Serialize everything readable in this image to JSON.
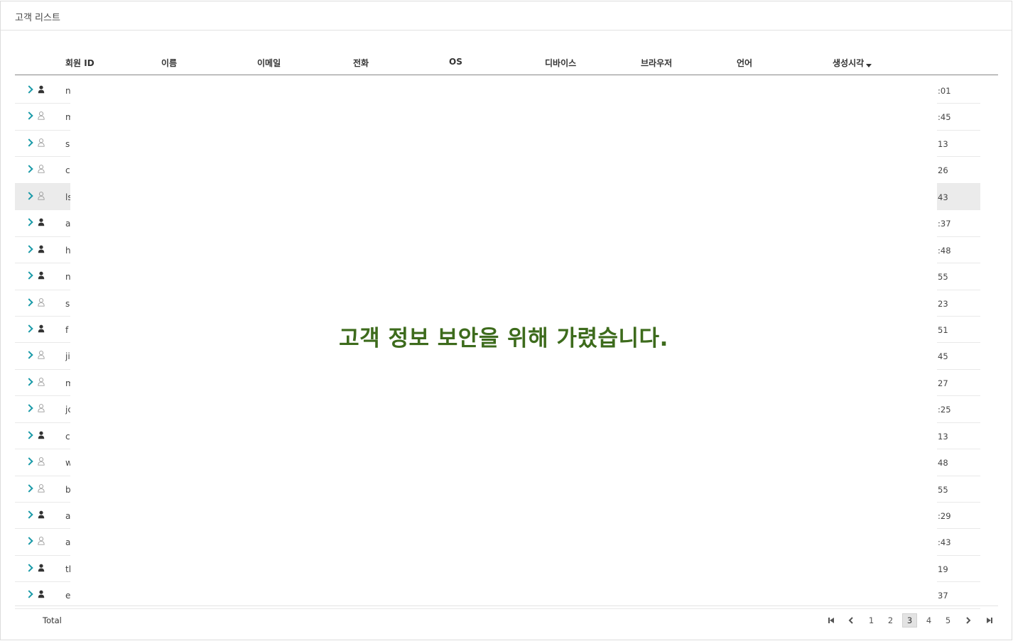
{
  "panel": {
    "title": "고객 리스트"
  },
  "table": {
    "columns": {
      "member_id": "회원 ID",
      "name": "이름",
      "email": "이메일",
      "phone": "전화",
      "os": "OS",
      "device": "디바이스",
      "browser": "브라우저",
      "language": "언어",
      "created_at": "생성시각"
    },
    "sorted_column": "created_at",
    "sort_direction": "desc",
    "rows": [
      {
        "icon": "user-filled-icon",
        "id_visible": "n",
        "time_visible": ":01"
      },
      {
        "icon": "user-outline-icon",
        "id_visible": "m",
        "time_visible": ":45"
      },
      {
        "icon": "user-outline-icon",
        "id_visible": "s",
        "time_visible": "13"
      },
      {
        "icon": "user-outline-icon",
        "id_visible": "c",
        "time_visible": "26"
      },
      {
        "icon": "user-outline-icon",
        "id_visible": "ls",
        "time_visible": "43",
        "highlight": true
      },
      {
        "icon": "user-filled-icon",
        "id_visible": "a",
        "time_visible": ":37"
      },
      {
        "icon": "user-filled-icon",
        "id_visible": "h",
        "time_visible": ":48"
      },
      {
        "icon": "user-filled-icon",
        "id_visible": "n",
        "time_visible": "55"
      },
      {
        "icon": "user-outline-icon",
        "id_visible": "s",
        "time_visible": "23"
      },
      {
        "icon": "user-filled-icon",
        "id_visible": "f",
        "time_visible": "51"
      },
      {
        "icon": "user-outline-icon",
        "id_visible": "ji",
        "time_visible": "45"
      },
      {
        "icon": "user-outline-icon",
        "id_visible": "m",
        "time_visible": "27"
      },
      {
        "icon": "user-outline-icon",
        "id_visible": "jc",
        "time_visible": ":25"
      },
      {
        "icon": "user-filled-icon",
        "id_visible": "c",
        "time_visible": "13"
      },
      {
        "icon": "user-outline-icon",
        "id_visible": "w",
        "time_visible": "48"
      },
      {
        "icon": "user-outline-icon",
        "id_visible": "b",
        "time_visible": "55"
      },
      {
        "icon": "user-filled-icon",
        "id_visible": "a",
        "time_visible": ":29"
      },
      {
        "icon": "user-outline-icon",
        "id_visible": "a",
        "time_visible": ":43"
      },
      {
        "icon": "user-filled-icon",
        "id_visible": "tl",
        "time_visible": "19"
      },
      {
        "icon": "user-filled-icon",
        "id_visible": "e",
        "time_visible": "37"
      }
    ]
  },
  "mask": {
    "message": "고객 정보 보안을 위해 가렸습니다.",
    "color": "#3d6b1c"
  },
  "footer": {
    "total_label": "Total",
    "pages": [
      "1",
      "2",
      "3",
      "4",
      "5"
    ],
    "current_page": "3"
  },
  "colors": {
    "accent": "#1a9aa8"
  }
}
